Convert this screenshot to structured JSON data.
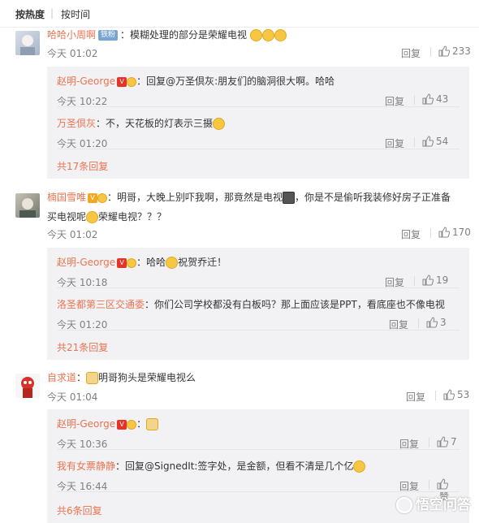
{
  "sort": {
    "hot": "按热度",
    "time": "按时间"
  },
  "reply_label": "回复",
  "comments": [
    {
      "user": "哈哈小周啊",
      "badge": "铁粉",
      "text": "：模糊处理的部分是荣耀电视",
      "time": "今天 01:02",
      "likes": "233",
      "subs": [
        {
          "user": "赵明-George",
          "text": "：回复@万圣倶灰:朋友们的脑洞很大啊。哈哈",
          "time": "今天 10:22",
          "likes": "43"
        },
        {
          "user": "万圣倶灰",
          "text": "：不，天花板的灯表示三摄",
          "time": "今天 01:20",
          "likes": "54"
        }
      ],
      "more": "共17条回复"
    },
    {
      "user": "楠国雪唯",
      "text": "：明哥，大晚上别吓我啊，那竟然是电视",
      "text_tail": "，你是不是偷听我装修好房子正准备",
      "text2": "买电视呢",
      "text2_tail": "荣耀电视？？？",
      "time": "今天 01:02",
      "likes": "170",
      "subs": [
        {
          "user": "赵明-George",
          "text": "：哈哈",
          "text_tail": "祝贺乔迁！",
          "time": "今天 10:18",
          "likes": "19"
        },
        {
          "user": "洛圣都第三区交通委",
          "text": "：你们公司学校都没有白板吗？那上面应该是PPT，看底座也不像电视",
          "time": "今天 01:20",
          "likes": "3"
        }
      ],
      "more": "共21条回复"
    },
    {
      "user": "自求道",
      "text": "明哥狗头是荣耀电视么",
      "time": "今天 01:04",
      "likes": "53",
      "subs": [
        {
          "user": "赵明-George",
          "text": "：",
          "time": "今天 10:36",
          "likes": "7"
        },
        {
          "user": "我有女票静静",
          "text": "：回复@SignedIt:签字处，是金额，但看不清是几个亿",
          "time": "今天 16:44",
          "likes": "赞"
        }
      ],
      "more": "共6条回复"
    }
  ],
  "watermark": "悟空问答",
  "colors": {
    "username": "#eb7350",
    "subbox": "#f2f2f5",
    "meta": "#808080"
  }
}
